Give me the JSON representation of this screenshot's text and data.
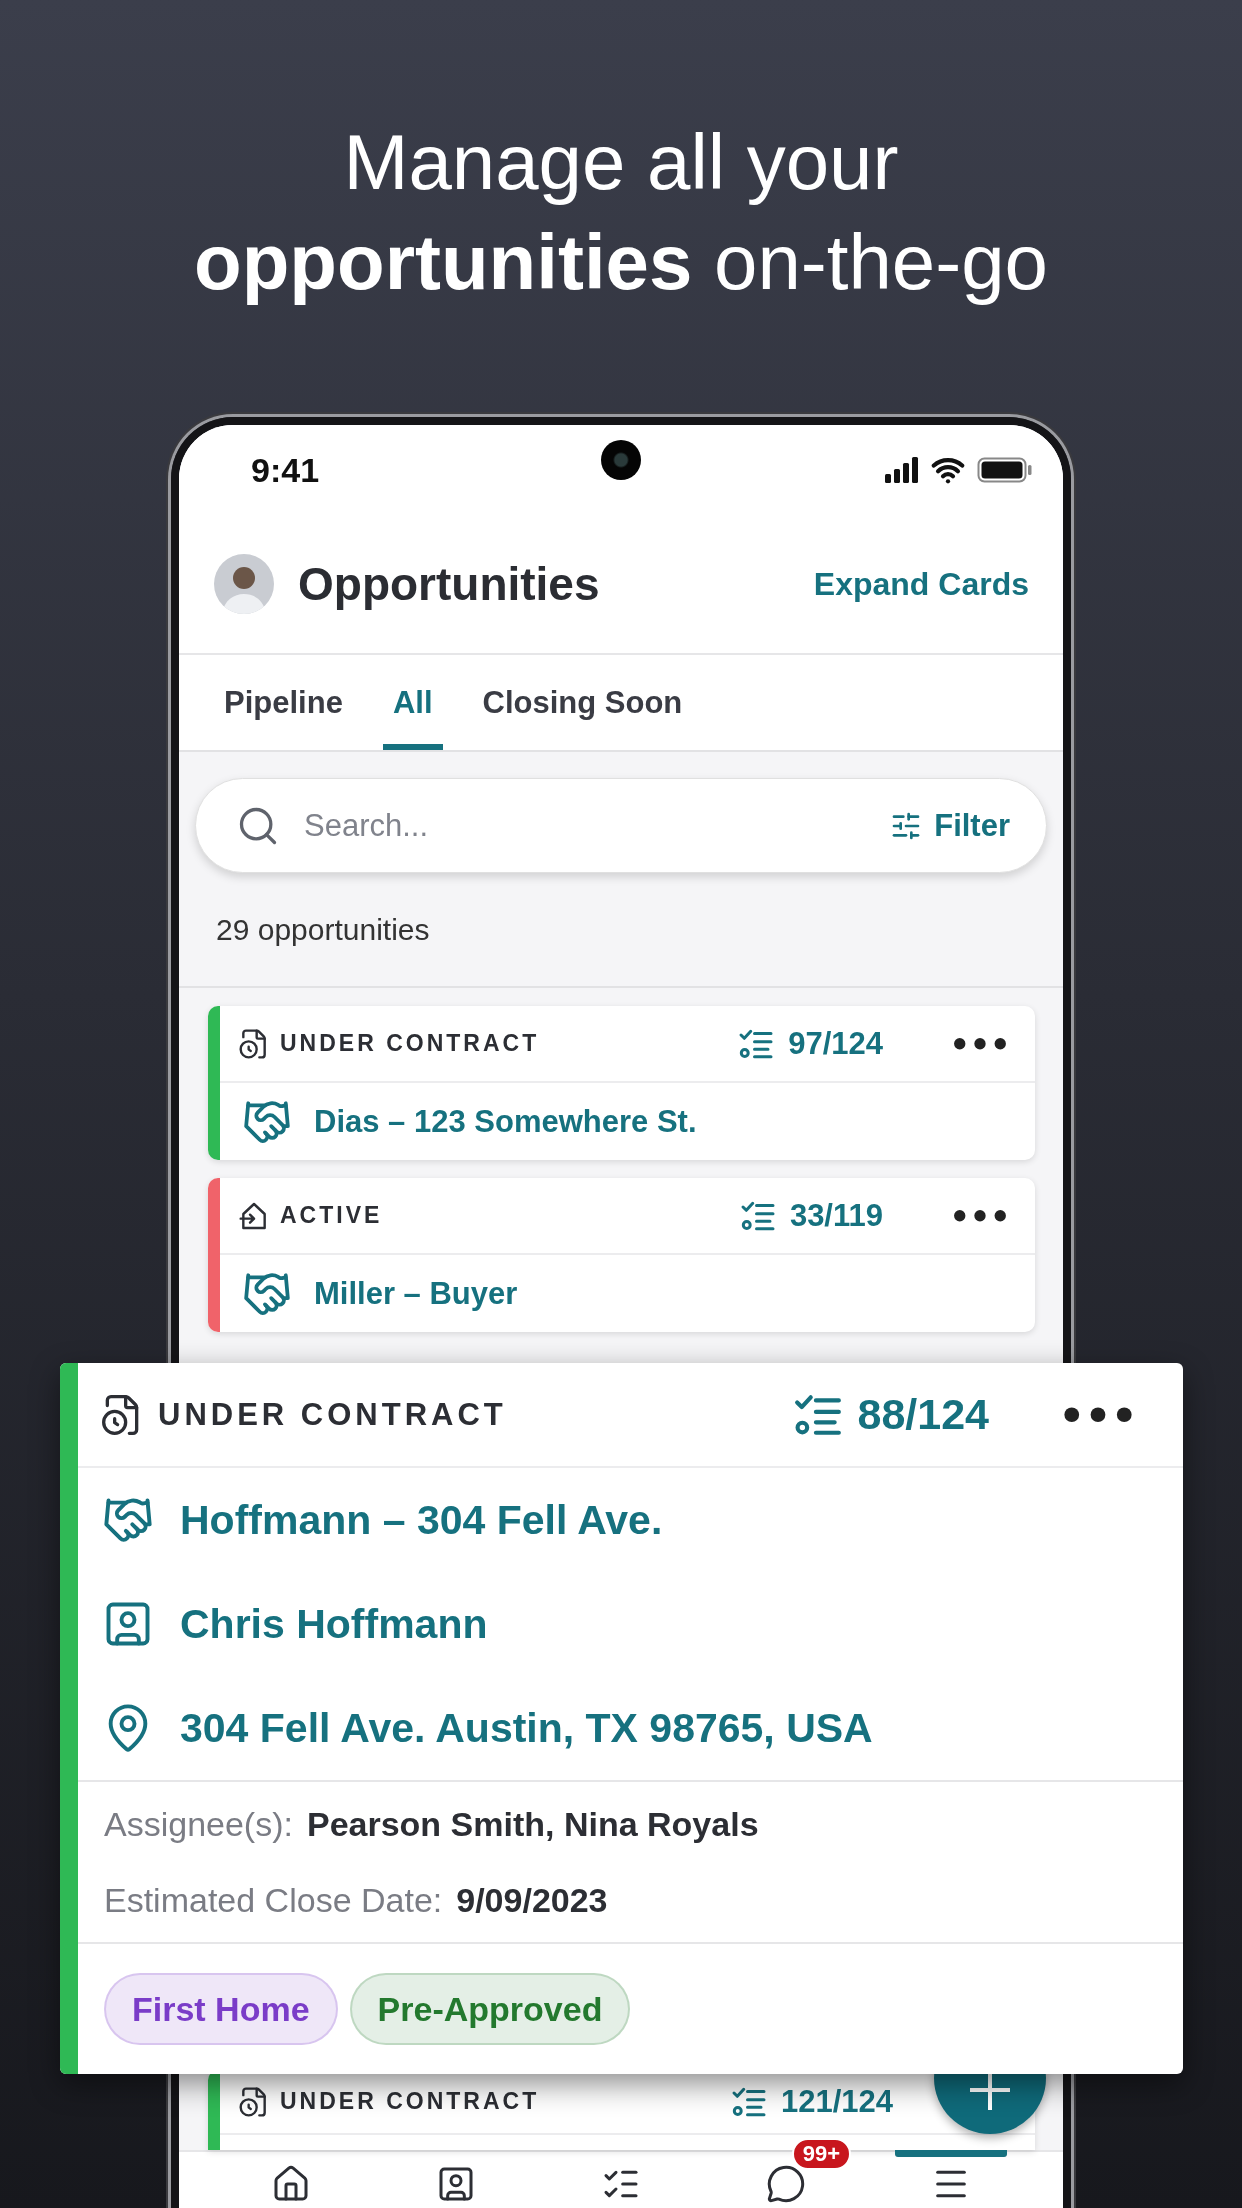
{
  "headline": [
    "Manage all your",
    "**opportunities** on-the-go"
  ],
  "status_bar": {
    "time": "9:41"
  },
  "header": {
    "title": "Opportunities",
    "action": "Expand Cards"
  },
  "tabs": [
    {
      "label": "Pipeline",
      "selected": false
    },
    {
      "label": "All",
      "selected": true
    },
    {
      "label": "Closing Soon",
      "selected": false
    }
  ],
  "search": {
    "placeholder": "Search...",
    "filter": "Filter"
  },
  "count": "29 opportunities",
  "cards": [
    {
      "kind": "under_contract",
      "status": "UNDER CONTRACT",
      "progress": "97/124",
      "color": "#2fb955",
      "title": "Dias – 123 Somewhere St."
    },
    {
      "kind": "active",
      "status": "ACTIVE",
      "progress": "33/119",
      "color": "#f0636a",
      "title": "Miller – Buyer"
    },
    {
      "kind": "under_contract",
      "status": "UNDER CONTRACT",
      "progress": "121/124",
      "color": "#2fb955"
    }
  ],
  "expanded_card": {
    "kind": "under_contract",
    "status": "UNDER CONTRACT",
    "progress": "88/124",
    "color": "#2fb955",
    "details": [
      {
        "kind": "deal",
        "text": "Hoffmann – 304 Fell Ave."
      },
      {
        "kind": "contact",
        "text": "Chris Hoffmann"
      },
      {
        "kind": "address",
        "text": "304 Fell Ave. Austin, TX 98765, USA"
      }
    ],
    "meta": [
      {
        "label": "Assignee(s):",
        "value": "Pearson Smith, Nina Royals"
      },
      {
        "label": "Estimated Close Date:",
        "value": "9/09/2023"
      }
    ],
    "tags": [
      {
        "label": "First Home",
        "color": "#7a3cc8"
      },
      {
        "label": "Pre-Approved",
        "color": "#23792e"
      }
    ]
  },
  "nav": [
    {
      "kind": "home",
      "selected": false
    },
    {
      "kind": "contacts",
      "selected": false
    },
    {
      "kind": "tasks",
      "selected": false
    },
    {
      "kind": "chat",
      "selected": false,
      "badge": "99+"
    },
    {
      "kind": "menu",
      "selected": true
    }
  ]
}
